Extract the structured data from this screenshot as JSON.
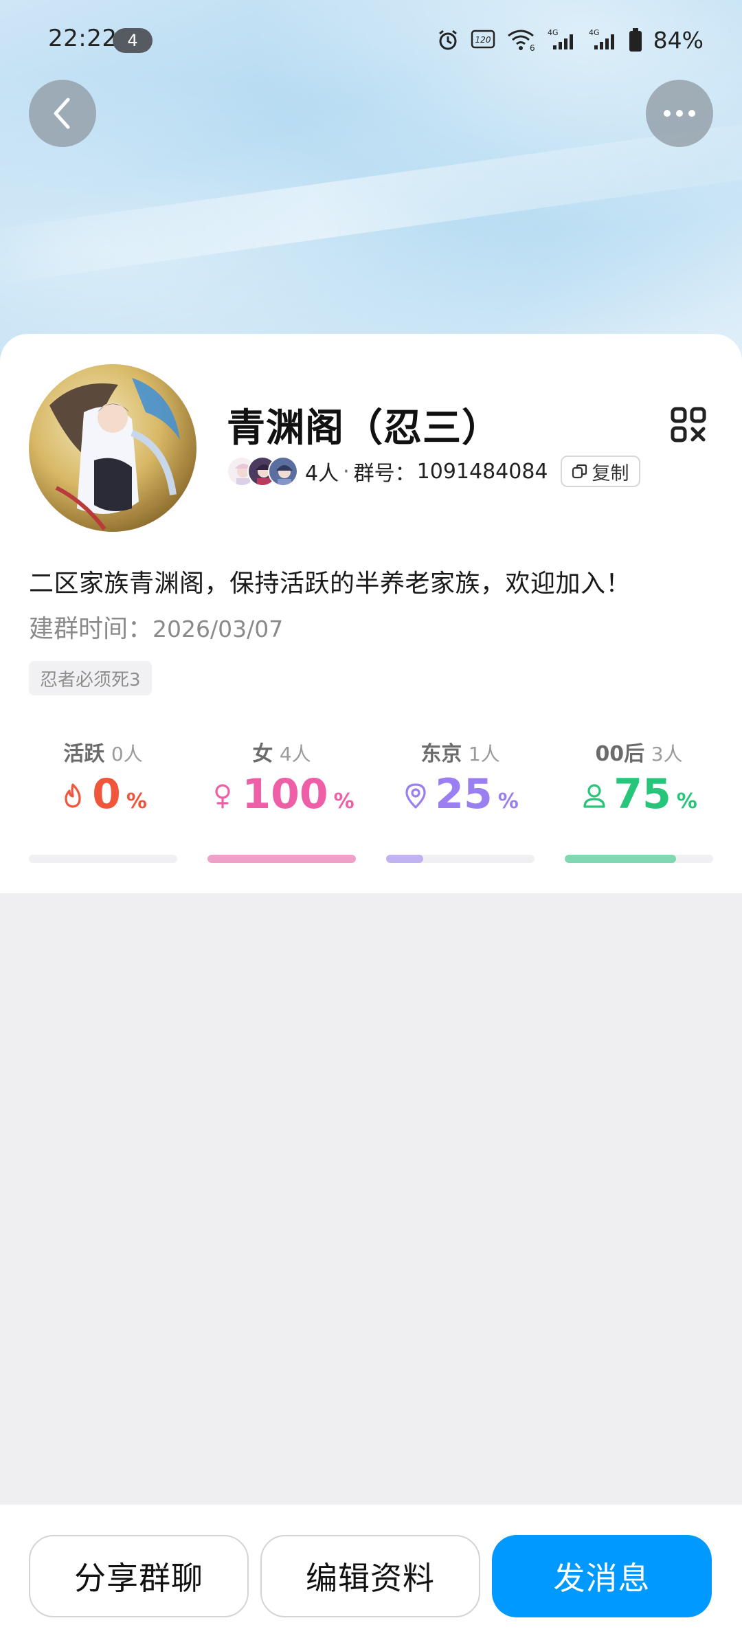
{
  "status_bar": {
    "time": "22:22",
    "notification_count": "4",
    "network_1": "4G",
    "network_2": "4G",
    "battery": "84%"
  },
  "group": {
    "name": "青渊阁（忍三）",
    "member_count": "4人",
    "id_label": "群号：",
    "id": "1091484084",
    "copy_label": "复制",
    "description": "二区家族青渊阁，保持活跃的半养老家族，欢迎加入！",
    "created_label": "建群时间：",
    "created_date": "2026/03/07",
    "tag": "忍者必须死3"
  },
  "stats": [
    {
      "label": "活跃",
      "count": "0人",
      "value": "0",
      "pct_sign": "%",
      "percent": 0,
      "color": "#f0563b",
      "icon": "flame-icon"
    },
    {
      "label": "女",
      "count": "4人",
      "value": "100",
      "pct_sign": "%",
      "percent": 100,
      "color": "#ef5fa7",
      "icon": "female-icon"
    },
    {
      "label": "东京",
      "count": "1人",
      "value": "25",
      "pct_sign": "%",
      "percent": 25,
      "color": "#9a7ff0",
      "icon": "location-pin-icon"
    },
    {
      "label": "00后",
      "count": "3人",
      "value": "75",
      "pct_sign": "%",
      "percent": 75,
      "color": "#27c57a",
      "icon": "person-icon"
    }
  ],
  "actions": {
    "share": "分享群聊",
    "edit": "编辑资料",
    "send": "发消息"
  }
}
